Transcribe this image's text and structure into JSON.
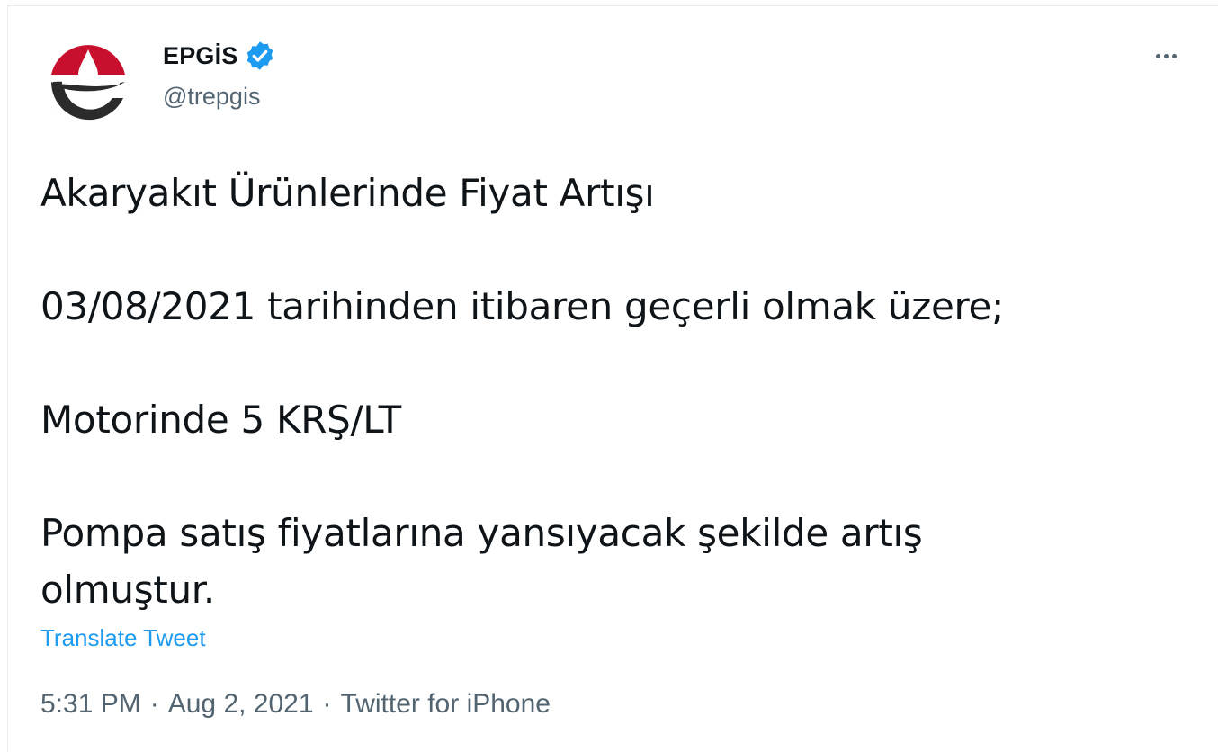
{
  "author": {
    "display_name": "EPGİS",
    "handle": "@trepgis",
    "verified": true
  },
  "tweet": {
    "text": "Akaryakıt Ürünlerinde Fiyat Artışı\n\n03/08/2021 tarihinden itibaren geçerli olmak üzere;\n\nMotorinde 5 KRŞ/LT\n\nPompa satış fiyatlarına yansıyacak şekilde artış\nolmuştur.",
    "translate_label": "Translate Tweet"
  },
  "meta": {
    "time": "5:31 PM",
    "separator": "·",
    "date": "Aug 2, 2021",
    "source": "Twitter for iPhone"
  },
  "colors": {
    "brand_blue": "#1d9bf0",
    "text": "#0f1419",
    "muted": "#536471",
    "logo_red": "#c8102e"
  }
}
